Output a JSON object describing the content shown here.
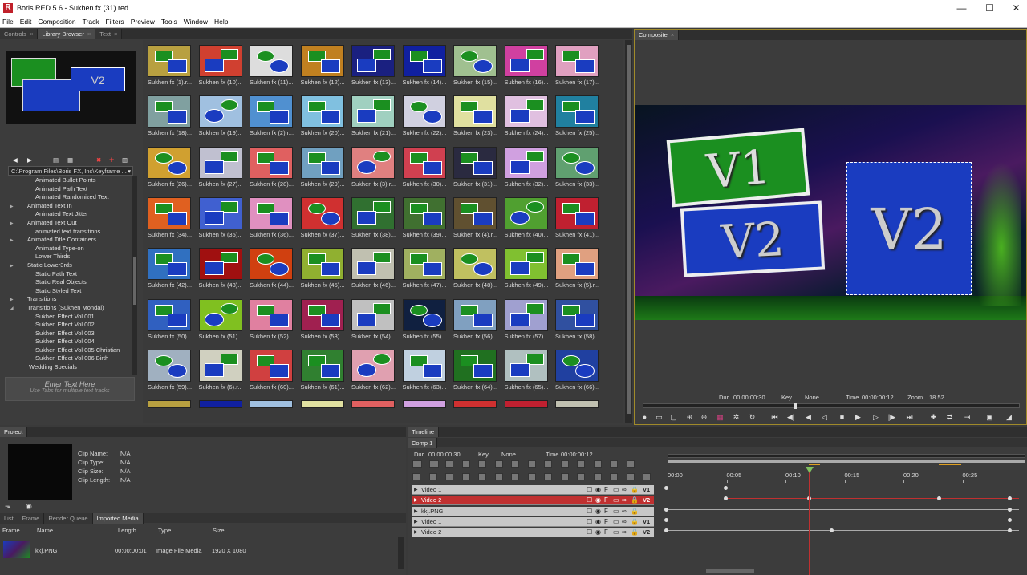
{
  "window": {
    "title": "Boris RED 5.6 - Sukhen fx (31).red",
    "app_letter": "R"
  },
  "menu": [
    "File",
    "Edit",
    "Composition",
    "Track",
    "Filters",
    "Preview",
    "Tools",
    "Window",
    "Help"
  ],
  "left_tabs": [
    "Controls",
    "Library Browser",
    "Text"
  ],
  "path_value": "C:\\Program Files\\Boris FX, Inc\\Keyframe ...",
  "tree": [
    {
      "label": "Animated Bullet Points",
      "arrow": ""
    },
    {
      "label": "Animated Path Text",
      "arrow": ""
    },
    {
      "label": "Animated Randomized Text",
      "arrow": ""
    },
    {
      "label": "Animated Text In",
      "arrow": "▶"
    },
    {
      "label": "Animated Text Jitter",
      "arrow": ""
    },
    {
      "label": "Animated Text Out",
      "arrow": "▶"
    },
    {
      "label": "animated text transitions",
      "arrow": ""
    },
    {
      "label": "Animated Title Containers",
      "arrow": "▶"
    },
    {
      "label": "Animated Type-on",
      "arrow": ""
    },
    {
      "label": "Lower Thirds",
      "arrow": ""
    },
    {
      "label": "Static Lower3rds",
      "arrow": "▶"
    },
    {
      "label": "Static Path Text",
      "arrow": ""
    },
    {
      "label": "Static Real Objects",
      "arrow": ""
    },
    {
      "label": "Static Styled Text",
      "arrow": ""
    },
    {
      "label": "Transitions",
      "arrow": "▶"
    },
    {
      "label": "Transitions (Sukhen Mondal)",
      "arrow": "◢"
    },
    {
      "label": "Sukhen    Effect Vol 001",
      "arrow": ""
    },
    {
      "label": "Sukhen    Effect Vol 002",
      "arrow": ""
    },
    {
      "label": "Sukhen    Effect Vol 003",
      "arrow": ""
    },
    {
      "label": "Sukhen    Effect Vol 004",
      "arrow": ""
    },
    {
      "label": "Sukhen    Effect Vol 005 Christian",
      "arrow": ""
    },
    {
      "label": "Sukhen    Effect Vol 006 Birth",
      "arrow": ""
    },
    {
      "label": "Wedding Specials",
      "arrow": ""
    }
  ],
  "text_entry": {
    "title": "Enter Text Here",
    "hint": "Use Tabs for multiple text tracks"
  },
  "library_items": [
    "Sukhen fx (1).r...",
    "Sukhen fx (10)...",
    "Sukhen fx (11)...",
    "Sukhen fx (12)...",
    "Sukhen fx (13)...",
    "Sukhen fx (14)...",
    "Sukhen fx (15)...",
    "Sukhen fx (16)...",
    "Sukhen fx (17)...",
    "Sukhen fx (18)...",
    "Sukhen fx (19)...",
    "Sukhen fx (2).r...",
    "Sukhen fx (20)...",
    "Sukhen fx (21)...",
    "Sukhen fx (22)...",
    "Sukhen fx (23)...",
    "Sukhen fx (24)...",
    "Sukhen fx (25)...",
    "Sukhen fx (26)...",
    "Sukhen fx (27)...",
    "Sukhen fx (28)...",
    "Sukhen fx (29)...",
    "Sukhen fx (3).r...",
    "Sukhen fx (30)...",
    "Sukhen fx (31)...",
    "Sukhen fx (32)...",
    "Sukhen fx (33)...",
    "Sukhen fx (34)...",
    "Sukhen fx (35)...",
    "Sukhen fx (36)...",
    "Sukhen fx (37)...",
    "Sukhen fx (38)...",
    "Sukhen fx (39)...",
    "Sukhen fx (4).r...",
    "Sukhen fx (40)...",
    "Sukhen fx (41)...",
    "Sukhen fx (42)...",
    "Sukhen fx (43)...",
    "Sukhen fx (44)...",
    "Sukhen fx (45)...",
    "Sukhen fx (46)...",
    "Sukhen fx (47)...",
    "Sukhen fx (48)...",
    "Sukhen fx (49)...",
    "Sukhen fx (5).r...",
    "Sukhen fx (50)...",
    "Sukhen fx (51)...",
    "Sukhen fx (52)...",
    "Sukhen fx (53)...",
    "Sukhen fx (54)...",
    "Sukhen fx (55)...",
    "Sukhen fx (56)...",
    "Sukhen fx (57)...",
    "Sukhen fx (58)...",
    "Sukhen fx (59)...",
    "Sukhen fx (6).r...",
    "Sukhen fx (60)...",
    "Sukhen fx (61)...",
    "Sukhen fx (62)...",
    "Sukhen fx (63)...",
    "Sukhen fx (64)...",
    "Sukhen fx (65)...",
    "Sukhen fx (66)..."
  ],
  "thumb_colors": [
    "#b8a040",
    "#d04030",
    "#dddddd",
    "#c08020",
    "#1a2080",
    "#1020a0",
    "#a0c090",
    "#d040a0",
    "#e0a0c0",
    "#80a0a0",
    "#a0c0e0",
    "#5090d0",
    "#80c0e0",
    "#a0d0c0",
    "#d0d0e0",
    "#e0e0a0",
    "#e0c0e0",
    "#2080a0",
    "#d0a030",
    "#c0c0d0",
    "#e06060",
    "#70a0c0",
    "#e08080",
    "#d04050",
    "#2a2a40",
    "#d0a0e0",
    "#60a070",
    "#e06020",
    "#4060d0",
    "#e090c0",
    "#d03030",
    "#307030",
    "#407030",
    "#605030",
    "#50a030",
    "#c02030",
    "#3070c0",
    "#a01010",
    "#d04010",
    "#90b030",
    "#c0c0b0",
    "#a0b060",
    "#c0c060",
    "#80c030",
    "#e0a080",
    "#3060c0",
    "#80c020",
    "#e080a0",
    "#a02050",
    "#c0c0c0",
    "#102040",
    "#80a0c0",
    "#a0a0d0",
    "#3050a0",
    "#a0b0c0",
    "#d0d0c0",
    "#d04040",
    "#308030",
    "#e0a0b0",
    "#c0d0e0",
    "#207020",
    "#b0c0c0",
    "#2040a0"
  ],
  "composite": {
    "tab": "Composite",
    "dur_label": "Dur",
    "dur": "00:00:00:30",
    "key_label": "Key.",
    "key": "None",
    "time_label": "Time",
    "time": "00:00:00:12",
    "zoom_label": "Zoom",
    "zoom": "18.52",
    "v1": "V1",
    "v2": "V2"
  },
  "project": {
    "tab": "Project",
    "clip_name_label": "Clip Name:",
    "clip_name": "N/A",
    "clip_type_label": "Clip Type:",
    "clip_type": "N/A",
    "clip_size_label": "Clip Size:",
    "clip_size": "N/A",
    "clip_length_label": "Clip Length:",
    "clip_length": "N/A",
    "subtabs": [
      "List",
      "Frame",
      "Render Queue",
      "Imported Media"
    ],
    "columns": [
      "Frame",
      "Name",
      "Length",
      "Type",
      "Size"
    ],
    "media": {
      "name": "kkj.PNG",
      "length": "00:00:00:01",
      "type": "Image File Media",
      "size": "1920 X 1080"
    }
  },
  "timeline": {
    "tab": "Timeline",
    "comp": "Comp 1",
    "dur_label": "Dur.",
    "dur": "00:00:00:30",
    "key_label": "Key.",
    "key": "None",
    "time_label": "Time",
    "time": "00:00:00:12",
    "ruler": [
      "00:00",
      "00:05",
      "00:10",
      "00:15",
      "00:20",
      "00:25"
    ],
    "tracks": [
      {
        "name": "Video 1",
        "tag": "V1"
      },
      {
        "name": "Video 2",
        "tag": "V2"
      },
      {
        "name": "kkj.PNG",
        "tag": ""
      },
      {
        "name": "Video 1",
        "tag": "V1"
      },
      {
        "name": "Video 2",
        "tag": "V2"
      }
    ]
  },
  "colors": {
    "accent_red": "#c03030",
    "v1_green": "#1b8f20",
    "v2_blue": "#1a3cc0"
  }
}
